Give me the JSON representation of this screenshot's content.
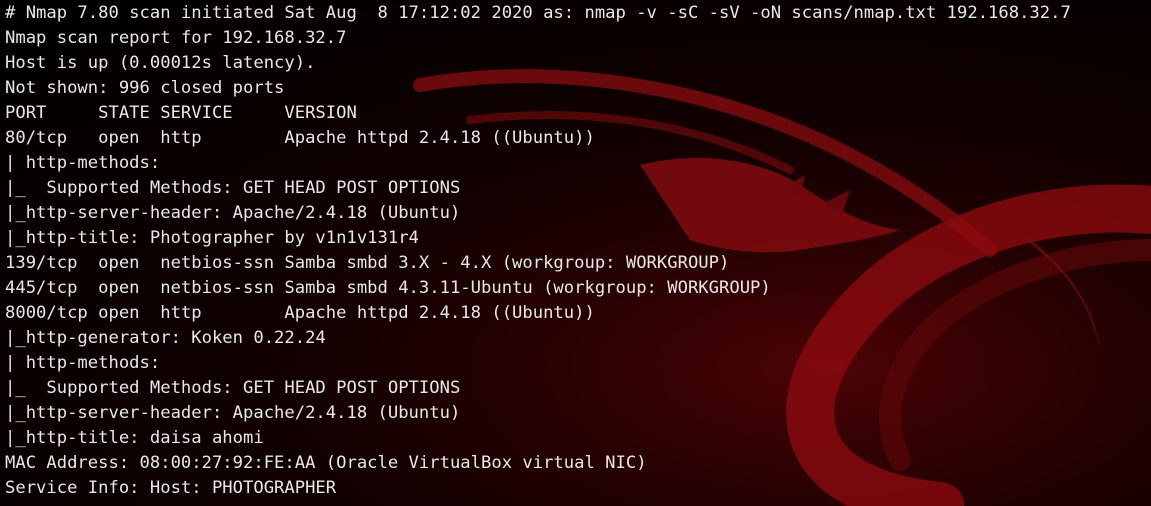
{
  "theme": {
    "text_color": "#e8e8e8",
    "background_color": "#000000",
    "wallpaper_accent": "#8b0a0e",
    "wallpaper_icon": "kali-dragon-logo"
  },
  "terminal": {
    "lines": [
      "# Nmap 7.80 scan initiated Sat Aug  8 17:12:02 2020 as: nmap -v -sC -sV -oN scans/nmap.txt 192.168.32.7",
      "Nmap scan report for 192.168.32.7",
      "Host is up (0.00012s latency).",
      "Not shown: 996 closed ports",
      "PORT     STATE SERVICE     VERSION",
      "80/tcp   open  http        Apache httpd 2.4.18 ((Ubuntu))",
      "| http-methods:",
      "|_  Supported Methods: GET HEAD POST OPTIONS",
      "|_http-server-header: Apache/2.4.18 (Ubuntu)",
      "|_http-title: Photographer by v1n1v131r4",
      "139/tcp  open  netbios-ssn Samba smbd 3.X - 4.X (workgroup: WORKGROUP)",
      "445/tcp  open  netbios-ssn Samba smbd 4.3.11-Ubuntu (workgroup: WORKGROUP)",
      "8000/tcp open  http        Apache httpd 2.4.18 ((Ubuntu))",
      "|_http-generator: Koken 0.22.24",
      "| http-methods:",
      "|_  Supported Methods: GET HEAD POST OPTIONS",
      "|_http-server-header: Apache/2.4.18 (Ubuntu)",
      "|_http-title: daisa ahomi",
      "MAC Address: 08:00:27:92:FE:AA (Oracle VirtualBox virtual NIC)",
      "Service Info: Host: PHOTOGRAPHER"
    ]
  }
}
